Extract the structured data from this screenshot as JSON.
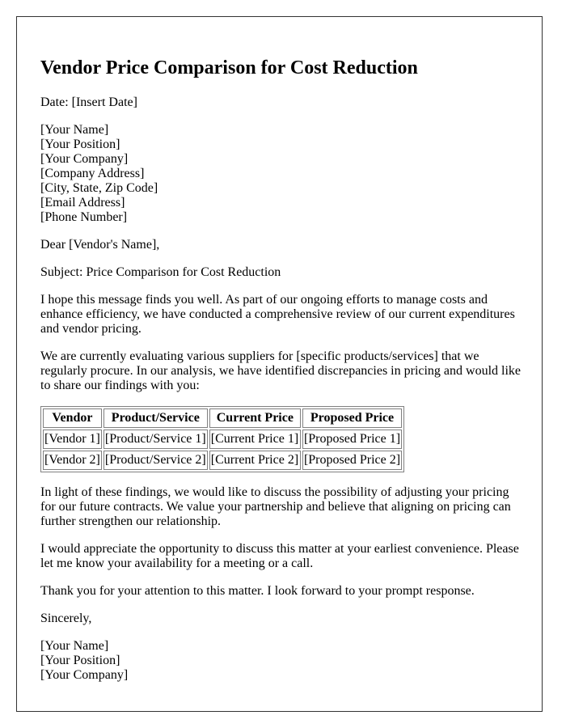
{
  "document": {
    "title": "Vendor Price Comparison for Cost Reduction",
    "date_line": "Date: [Insert Date]",
    "sender": [
      "[Your Name]",
      "[Your Position]",
      "[Your Company]",
      "[Company Address]",
      "[City, State, Zip Code]",
      "[Email Address]",
      "[Phone Number]"
    ],
    "salutation": "Dear [Vendor's Name],",
    "subject": "Subject: Price Comparison for Cost Reduction",
    "paragraphs_before_table": [
      "I hope this message finds you well. As part of our ongoing efforts to manage costs and enhance efficiency, we have conducted a comprehensive review of our current expenditures and vendor pricing.",
      "We are currently evaluating various suppliers for [specific products/services] that we regularly procure. In our analysis, we have identified discrepancies in pricing and would like to share our findings with you:"
    ],
    "table": {
      "headers": [
        "Vendor",
        "Product/Service",
        "Current Price",
        "Proposed Price"
      ],
      "rows": [
        [
          "[Vendor 1]",
          "[Product/Service 1]",
          "[Current Price 1]",
          "[Proposed Price 1]"
        ],
        [
          "[Vendor 2]",
          "[Product/Service 2]",
          "[Current Price 2]",
          "[Proposed Price 2]"
        ]
      ]
    },
    "paragraphs_after_table": [
      "In light of these findings, we would like to discuss the possibility of adjusting your pricing for our future contracts. We value your partnership and believe that aligning on pricing can further strengthen our relationship.",
      "I would appreciate the opportunity to discuss this matter at your earliest convenience. Please let me know your availability for a meeting or a call.",
      "Thank you for your attention to this matter. I look forward to your prompt response."
    ],
    "closing": "Sincerely,",
    "signature": [
      "[Your Name]",
      "[Your Position]",
      "[Your Company]"
    ]
  }
}
